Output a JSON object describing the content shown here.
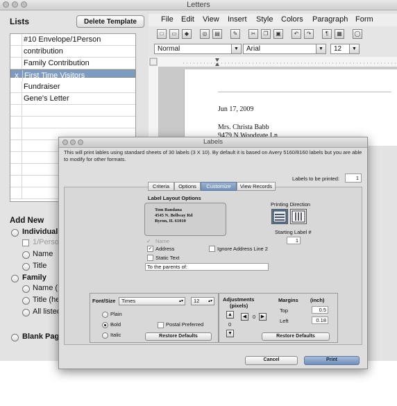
{
  "window": {
    "title": "Letters"
  },
  "lists": {
    "label": "Lists",
    "delete_button": "Delete Template",
    "items": [
      {
        "check": "",
        "label": "#10 Envelope/1Person"
      },
      {
        "check": "",
        "label": "contribution"
      },
      {
        "check": "",
        "label": "Family Contribution"
      },
      {
        "check": "x",
        "label": "First Time Visitors"
      },
      {
        "check": "",
        "label": "Fundraiser"
      },
      {
        "check": "",
        "label": "Gene's Letter"
      }
    ]
  },
  "add_new": {
    "label": "Add New",
    "individual": "Individual",
    "one_person": "1/Person",
    "ind_name": "Name",
    "ind_title": "Title",
    "family": "Family",
    "fam_name": "Name (",
    "fam_title": "Title (he",
    "all_listed": "All listed",
    "blank_page": "Blank Pag"
  },
  "menubar": [
    "File",
    "Edit",
    "View",
    "Insert",
    "Style",
    "Colors",
    "Paragraph",
    "Form"
  ],
  "format": {
    "style": "Normal",
    "font": "Arial",
    "size": "12"
  },
  "document": {
    "date": "Jun 17, 2009",
    "recipient": "Mrs. Christa Babb",
    "address": "9479 N Woodgate Ln"
  },
  "dialog": {
    "title": "Labels",
    "intro": "This will print lables using standard sheets of 30 labels (3 X 10).  By default it is based on Avery 5160/8160 labels but you are able to modify for other formats.",
    "labels_to_print_label": "Labels to be printed:",
    "labels_to_print_value": "1",
    "tabs": [
      "Criteria",
      "Options",
      "Customize",
      "View Records"
    ],
    "active_tab": "Customize",
    "layout_options_label": "Label Layout Options",
    "preview_lines": [
      "Tom Bandana",
      "4545 N. Bellway Rd",
      "Byron, IL  61010"
    ],
    "printing_direction_label": "Printing Direction",
    "starting_label_label": "Starting Label #",
    "starting_label_value": "1",
    "opt_name": "Name",
    "opt_address": "Address",
    "opt_ignore_line2": "Ignore Address Line 2",
    "opt_static_text": "Static Text",
    "static_text_value": "To the parents of:",
    "font_size_label": "Font/Size",
    "font_value": "Times",
    "size_value": "12",
    "style_plain": "Plain",
    "style_bold": "Bold",
    "style_italic": "Italic",
    "postal_preferred": "Postal Preferred",
    "restore_defaults": "Restore Defaults",
    "adjustments_label": "Adjustments",
    "adjustments_unit": "(pixels)",
    "adj_horizontal": "0",
    "adj_vertical": "0",
    "margins_label": "Margins",
    "margins_unit": "(inch)",
    "margin_top_label": "Top",
    "margin_top_value": "0.5",
    "margin_left_label": "Left",
    "margin_left_value": "0.18",
    "cancel_button": "Cancel",
    "print_button": "Print"
  },
  "colors": {
    "selection": "#7d9cc3",
    "print_button": "#7f9cc4"
  }
}
